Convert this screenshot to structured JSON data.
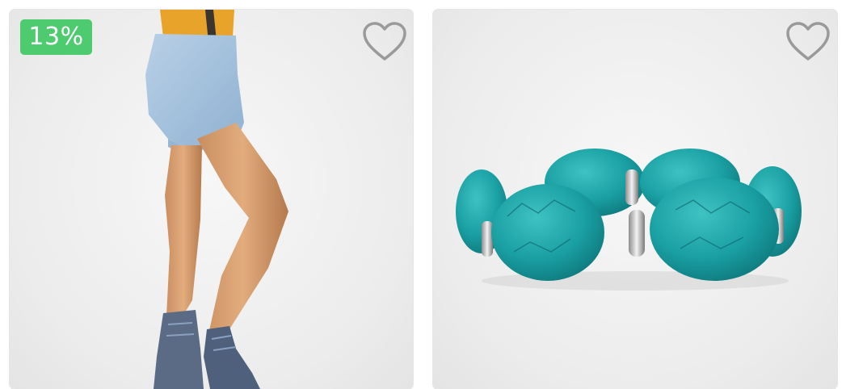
{
  "products": [
    {
      "discount": "13%",
      "wishlist_icon": "heart-outline-icon",
      "image": "denim-shorts"
    },
    {
      "wishlist_icon": "heart-outline-icon",
      "image": "turquoise-bracelet"
    }
  ],
  "colors": {
    "badge": "#4ecb6e",
    "heart_outline": "#9a9a9a",
    "turquoise": "#1ea6a8",
    "denim": "#a9c4dc",
    "mustard": "#e9a52c"
  }
}
